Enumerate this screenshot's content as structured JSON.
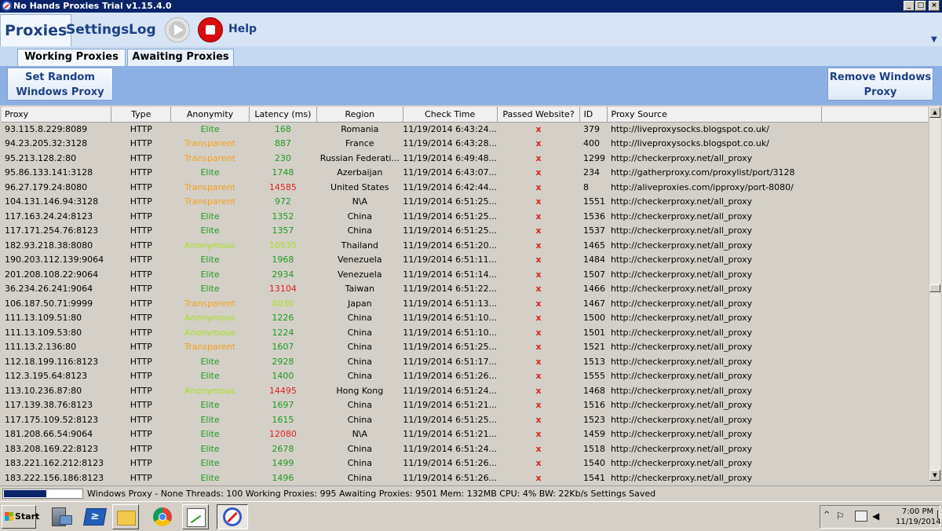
{
  "window": {
    "title": "No Hands Proxies Trial v1.15.4.0",
    "min_glyph": "_",
    "max_glyph": "□",
    "close_glyph": "×"
  },
  "menu": {
    "proxies": "Proxies",
    "settings": "Settings",
    "log": "Log",
    "help": "Help",
    "dropdown_glyph": "▼"
  },
  "tabs": {
    "working": "Working Proxies",
    "awaiting": "Awaiting Proxies"
  },
  "actions": {
    "set_random_line1": "Set Random",
    "set_random_line2": "Windows Proxy",
    "remove_line1": "Remove Windows",
    "remove_line2": "Proxy"
  },
  "table": {
    "columns": [
      "Proxy",
      "Type",
      "Anonymity",
      "Latency (ms)",
      "Region",
      "Check Time",
      "Passed Website?",
      "ID",
      "Proxy Source"
    ],
    "rows": [
      {
        "proxy": "93.115.8.229:8089",
        "type": "HTTP",
        "anonymity": "Elite",
        "latency": "168",
        "lat_color": "green",
        "region": "Romania",
        "check": "11/19/2014 6:43:24...",
        "passed": "x",
        "id": "379",
        "source": "http://liveproxysocks.blogspot.co.uk/"
      },
      {
        "proxy": "94.23.205.32:3128",
        "type": "HTTP",
        "anonymity": "Transparent",
        "latency": "887",
        "lat_color": "green",
        "region": "France",
        "check": "11/19/2014 6:43:28...",
        "passed": "x",
        "id": "400",
        "source": "http://liveproxysocks.blogspot.co.uk/"
      },
      {
        "proxy": "95.213.128.2:80",
        "type": "HTTP",
        "anonymity": "Transparent",
        "latency": "230",
        "lat_color": "green",
        "region": "Russian Federati...",
        "check": "11/19/2014 6:49:48...",
        "passed": "x",
        "id": "1299",
        "source": "http://checkerproxy.net/all_proxy"
      },
      {
        "proxy": "95.86.133.141:3128",
        "type": "HTTP",
        "anonymity": "Elite",
        "latency": "1748",
        "lat_color": "green",
        "region": "Azerbaijan",
        "check": "11/19/2014 6:43:07...",
        "passed": "x",
        "id": "234",
        "source": "http://gatherproxy.com/proxylist/port/3128"
      },
      {
        "proxy": "96.27.179.24:8080",
        "type": "HTTP",
        "anonymity": "Transparent",
        "latency": "14585",
        "lat_color": "red",
        "region": "United States",
        "check": "11/19/2014 6:42:44...",
        "passed": "x",
        "id": "8",
        "source": "http://aliveproxies.com/ipproxy/port-8080/"
      },
      {
        "proxy": "104.131.146.94:3128",
        "type": "HTTP",
        "anonymity": "Transparent",
        "latency": "972",
        "lat_color": "green",
        "region": "N\\A",
        "check": "11/19/2014 6:51:25...",
        "passed": "x",
        "id": "1551",
        "source": "http://checkerproxy.net/all_proxy"
      },
      {
        "proxy": "117.163.24.24:8123",
        "type": "HTTP",
        "anonymity": "Elite",
        "latency": "1352",
        "lat_color": "green",
        "region": "China",
        "check": "11/19/2014 6:51:25...",
        "passed": "x",
        "id": "1536",
        "source": "http://checkerproxy.net/all_proxy"
      },
      {
        "proxy": "117.171.254.76:8123",
        "type": "HTTP",
        "anonymity": "Elite",
        "latency": "1357",
        "lat_color": "green",
        "region": "China",
        "check": "11/19/2014 6:51:25...",
        "passed": "x",
        "id": "1537",
        "source": "http://checkerproxy.net/all_proxy"
      },
      {
        "proxy": "182.93.218.38:8080",
        "type": "HTTP",
        "anonymity": "Anonymous",
        "latency": "10535",
        "lat_color": "lightgreen",
        "region": "Thailand",
        "check": "11/19/2014 6:51:20...",
        "passed": "x",
        "id": "1465",
        "source": "http://checkerproxy.net/all_proxy"
      },
      {
        "proxy": "190.203.112.139:9064",
        "type": "HTTP",
        "anonymity": "Elite",
        "latency": "1968",
        "lat_color": "green",
        "region": "Venezuela",
        "check": "11/19/2014 6:51:11...",
        "passed": "x",
        "id": "1484",
        "source": "http://checkerproxy.net/all_proxy"
      },
      {
        "proxy": "201.208.108.22:9064",
        "type": "HTTP",
        "anonymity": "Elite",
        "latency": "2934",
        "lat_color": "green",
        "region": "Venezuela",
        "check": "11/19/2014 6:51:14...",
        "passed": "x",
        "id": "1507",
        "source": "http://checkerproxy.net/all_proxy"
      },
      {
        "proxy": "36.234.26.241:9064",
        "type": "HTTP",
        "anonymity": "Elite",
        "latency": "13104",
        "lat_color": "red",
        "region": "Taiwan",
        "check": "11/19/2014 6:51:22...",
        "passed": "x",
        "id": "1466",
        "source": "http://checkerproxy.net/all_proxy"
      },
      {
        "proxy": "106.187.50.71:9999",
        "type": "HTTP",
        "anonymity": "Transparent",
        "latency": "4030",
        "lat_color": "lightgreen",
        "region": "Japan",
        "check": "11/19/2014 6:51:13...",
        "passed": "x",
        "id": "1467",
        "source": "http://checkerproxy.net/all_proxy"
      },
      {
        "proxy": "111.13.109.51:80",
        "type": "HTTP",
        "anonymity": "Anonymous",
        "latency": "1226",
        "lat_color": "green",
        "region": "China",
        "check": "11/19/2014 6:51:10...",
        "passed": "x",
        "id": "1500",
        "source": "http://checkerproxy.net/all_proxy"
      },
      {
        "proxy": "111.13.109.53:80",
        "type": "HTTP",
        "anonymity": "Anonymous",
        "latency": "1224",
        "lat_color": "green",
        "region": "China",
        "check": "11/19/2014 6:51:10...",
        "passed": "x",
        "id": "1501",
        "source": "http://checkerproxy.net/all_proxy"
      },
      {
        "proxy": "111.13.2.136:80",
        "type": "HTTP",
        "anonymity": "Transparent",
        "latency": "1607",
        "lat_color": "green",
        "region": "China",
        "check": "11/19/2014 6:51:25...",
        "passed": "x",
        "id": "1521",
        "source": "http://checkerproxy.net/all_proxy"
      },
      {
        "proxy": "112.18.199.116:8123",
        "type": "HTTP",
        "anonymity": "Elite",
        "latency": "2928",
        "lat_color": "green",
        "region": "China",
        "check": "11/19/2014 6:51:17...",
        "passed": "x",
        "id": "1513",
        "source": "http://checkerproxy.net/all_proxy"
      },
      {
        "proxy": "112.3.195.64:8123",
        "type": "HTTP",
        "anonymity": "Elite",
        "latency": "1400",
        "lat_color": "green",
        "region": "China",
        "check": "11/19/2014 6:51:26...",
        "passed": "x",
        "id": "1555",
        "source": "http://checkerproxy.net/all_proxy"
      },
      {
        "proxy": "113.10.236.87:80",
        "type": "HTTP",
        "anonymity": "Anonymous",
        "latency": "14495",
        "lat_color": "red",
        "region": "Hong Kong",
        "check": "11/19/2014 6:51:24...",
        "passed": "x",
        "id": "1468",
        "source": "http://checkerproxy.net/all_proxy"
      },
      {
        "proxy": "117.139.38.76:8123",
        "type": "HTTP",
        "anonymity": "Elite",
        "latency": "1697",
        "lat_color": "green",
        "region": "China",
        "check": "11/19/2014 6:51:21...",
        "passed": "x",
        "id": "1516",
        "source": "http://checkerproxy.net/all_proxy"
      },
      {
        "proxy": "117.175.109.52:8123",
        "type": "HTTP",
        "anonymity": "Elite",
        "latency": "1615",
        "lat_color": "green",
        "region": "China",
        "check": "11/19/2014 6:51:25...",
        "passed": "x",
        "id": "1523",
        "source": "http://checkerproxy.net/all_proxy"
      },
      {
        "proxy": "181.208.66.54:9064",
        "type": "HTTP",
        "anonymity": "Elite",
        "latency": "12080",
        "lat_color": "red",
        "region": "N\\A",
        "check": "11/19/2014 6:51:21...",
        "passed": "x",
        "id": "1459",
        "source": "http://checkerproxy.net/all_proxy"
      },
      {
        "proxy": "183.208.169.22:8123",
        "type": "HTTP",
        "anonymity": "Elite",
        "latency": "2678",
        "lat_color": "green",
        "region": "China",
        "check": "11/19/2014 6:51:24...",
        "passed": "x",
        "id": "1518",
        "source": "http://checkerproxy.net/all_proxy"
      },
      {
        "proxy": "183.221.162.212:8123",
        "type": "HTTP",
        "anonymity": "Elite",
        "latency": "1499",
        "lat_color": "green",
        "region": "China",
        "check": "11/19/2014 6:51:26...",
        "passed": "x",
        "id": "1540",
        "source": "http://checkerproxy.net/all_proxy"
      },
      {
        "proxy": "183.222.156.186:8123",
        "type": "HTTP",
        "anonymity": "Elite",
        "latency": "1496",
        "lat_color": "green",
        "region": "China",
        "check": "11/19/2014 6:51:26...",
        "passed": "x",
        "id": "1541",
        "source": "http://checkerproxy.net/all_proxy"
      }
    ]
  },
  "scroll": {
    "up_glyph": "▲",
    "down_glyph": "▼"
  },
  "status": {
    "progress": 0.55,
    "text": "Windows Proxy - None  Threads: 100  Working Proxies: 995  Awaiting Proxies: 9501  Mem: 132MB  CPU: 4%  BW: 22Kb/s  Settings Saved"
  },
  "taskbar": {
    "start_label": "Start",
    "powershell_glyph": "≥",
    "tray_chevron": "^",
    "tray_flag_glyph": "⚐",
    "tray_volume_glyph": "◀",
    "clock_time": "7:00 PM",
    "clock_date": "11/19/2014",
    "show_desktop_glyph": "▕"
  },
  "colors": {
    "title_bg": "#0a246a",
    "elite": "#1e9a1e",
    "transparent": "#f5a01a",
    "anonymous": "#a6e020",
    "error": "#e0201c"
  }
}
